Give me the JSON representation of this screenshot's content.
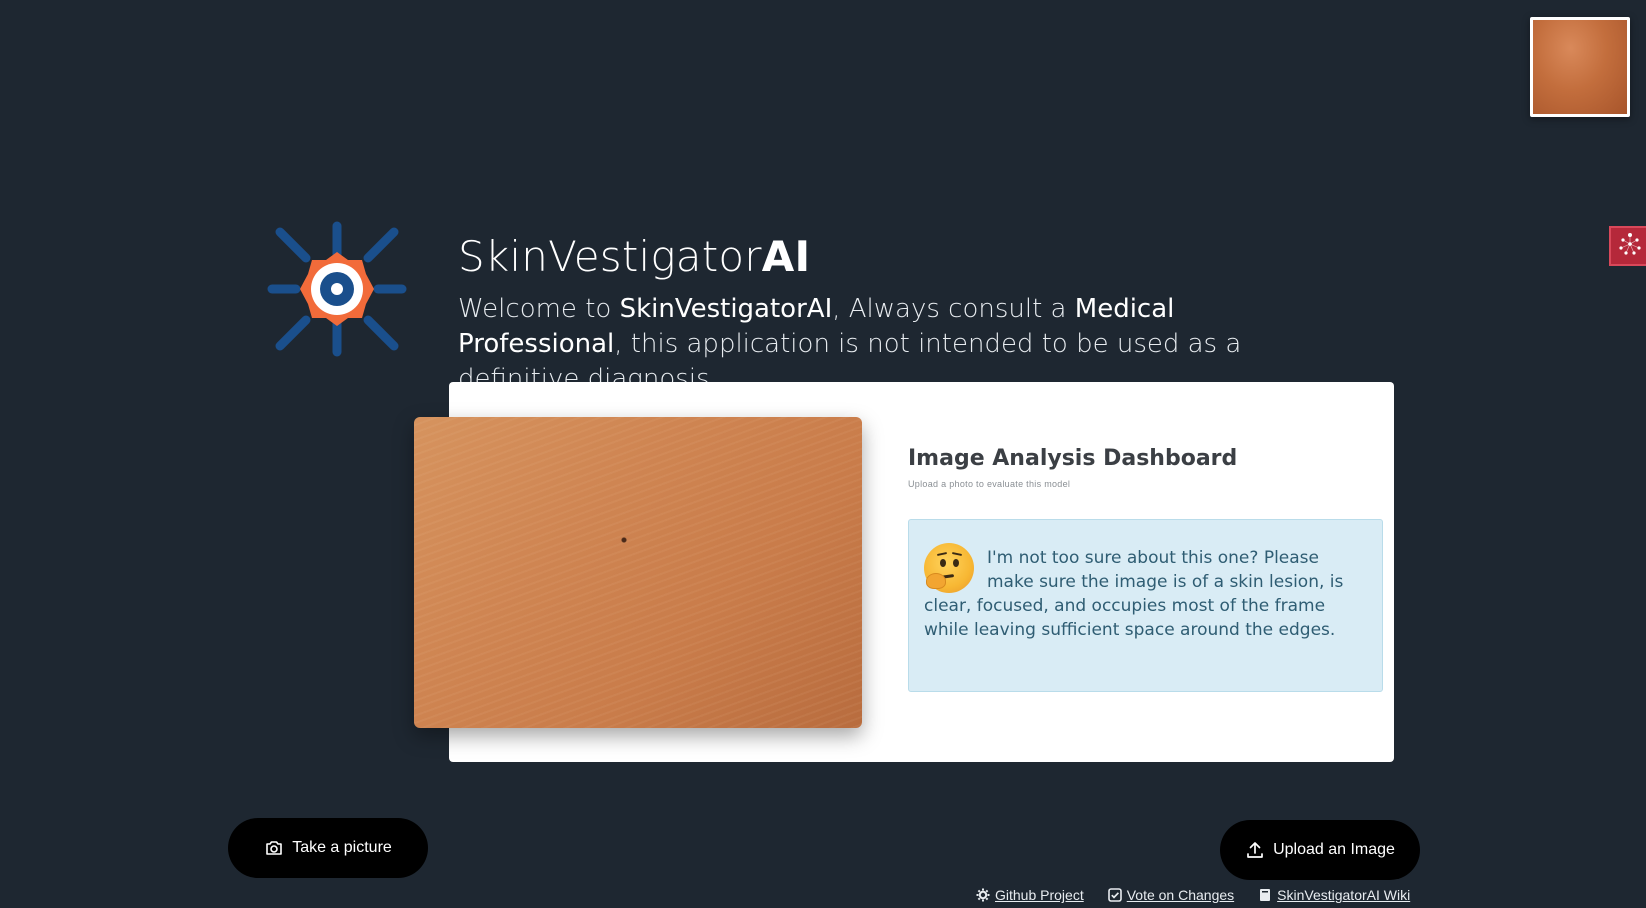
{
  "header": {
    "title_regular": "SkinVestigator",
    "title_bold": "AI",
    "tagline_1": "Welcome to ",
    "tagline_brand": "SkinVestigatorAI",
    "tagline_2": ",  Always consult a ",
    "tagline_pro": "Medical Professional",
    "tagline_3": ", this application is not intended to be used as a definitive diagnosis ."
  },
  "dashboard": {
    "title": "Image Analysis Dashboard",
    "subtitle": "Upload a photo to evaluate this model",
    "notice": "I'm not too sure about this one? Please make sure the image is of a skin lesion, is clear, focused, and occupies most of the frame while leaving sufficient space around the edges.",
    "notice_icon": "thinking-face-emoji"
  },
  "actions": {
    "camera_label": "Take a picture",
    "upload_label": "Upload an Image"
  },
  "footer": {
    "links": [
      {
        "label": "Github Project",
        "icon": "gear-icon"
      },
      {
        "label": "Vote on Changes",
        "icon": "checkbox-icon"
      },
      {
        "label": "SkinVestigatorAI Wiki",
        "icon": "book-icon"
      }
    ]
  },
  "colors": {
    "background": "#1e2731",
    "card": "#ffffff",
    "notice_bg": "#d9ecf5",
    "notice_text": "#2f5d73",
    "button": "#000000",
    "logo_blue": "#1a4f8c",
    "logo_orange": "#f26b3a",
    "side_tab": "#b5283a"
  }
}
